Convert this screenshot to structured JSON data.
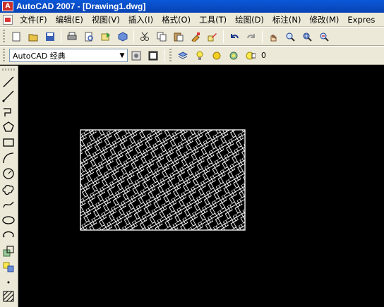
{
  "titlebar": {
    "logo": "A",
    "title": "AutoCAD 2007 - [Drawing1.dwg]"
  },
  "menubar": {
    "items": [
      "文件(F)",
      "编辑(E)",
      "视图(V)",
      "插入(I)",
      "格式(O)",
      "工具(T)",
      "绘图(D)",
      "标注(N)",
      "修改(M)",
      "Expres"
    ]
  },
  "toolbar_standard": {
    "buttons": [
      "new-icon",
      "open-icon",
      "save-icon",
      "print-icon",
      "print-preview-icon",
      "publish-icon",
      "3d-publish-icon",
      "cut-icon",
      "copy-icon",
      "paste-icon",
      "match-properties-icon",
      "block-editor-icon",
      "undo-icon",
      "redo-icon",
      "pan-icon",
      "zoom-realtime-icon",
      "zoom-window-icon",
      "zoom-previous-icon"
    ]
  },
  "toolbar_workspace": {
    "workspace_value": "AutoCAD 经典",
    "layer_value": "0"
  },
  "draw_tools": [
    "line-icon",
    "construction-line-icon",
    "polyline-icon",
    "polygon-icon",
    "rectangle-icon",
    "arc-icon",
    "circle-icon",
    "revision-cloud-icon",
    "spline-icon",
    "ellipse-icon",
    "ellipse-arc-icon",
    "insert-block-icon",
    "make-block-icon",
    "point-icon",
    "hatch-icon"
  ],
  "colors": {
    "canvas": "#000000",
    "hatch": "#ffffff",
    "chrome": "#ece9d8",
    "titlebar": "#0a58d8"
  }
}
